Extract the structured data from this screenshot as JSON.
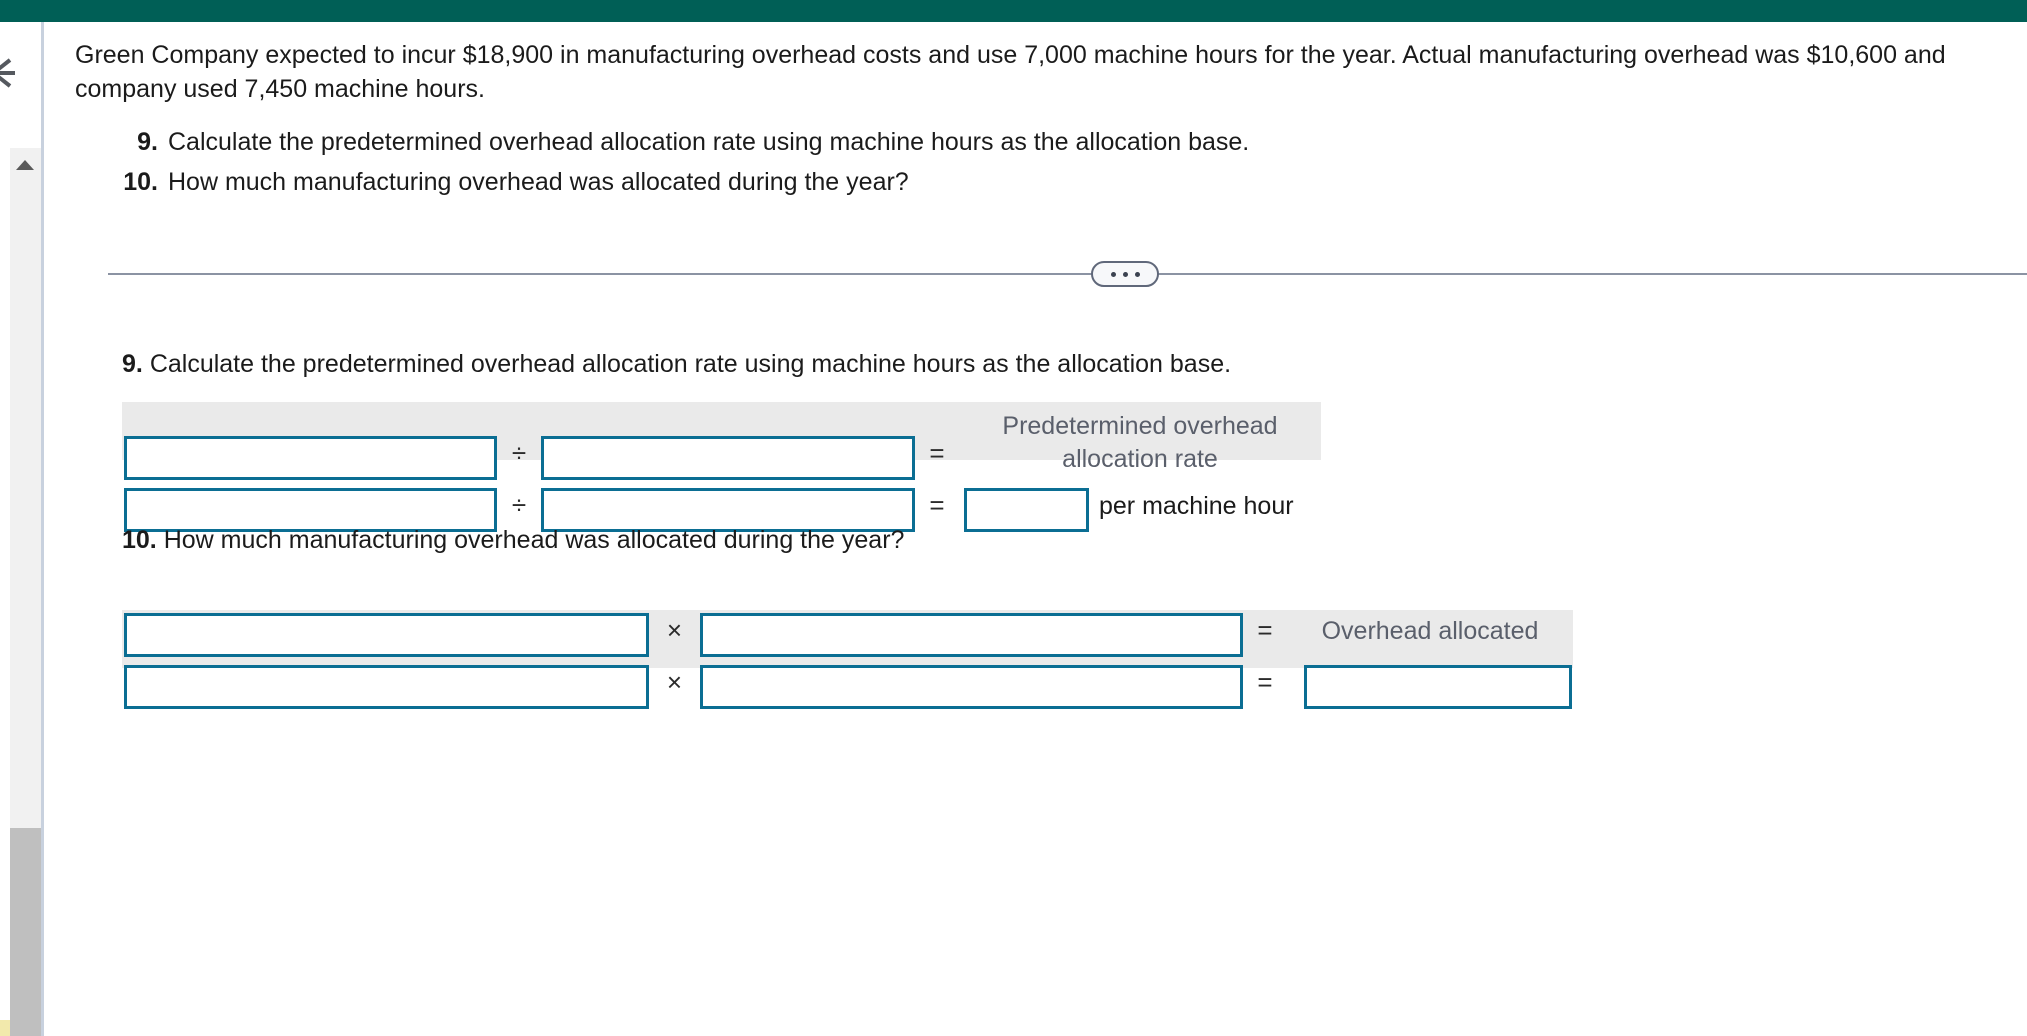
{
  "header": {
    "bar_color": "#005f56"
  },
  "left_rail": {
    "collapse_icon": "collapse-chevron-icon",
    "scroll_up_icon": "scroll-up-arrow-icon"
  },
  "prompt": {
    "text": "Green Company expected to incur $18,900 in manufacturing overhead costs and use 7,000 machine hours for the year. Actual manufacturing overhead was $10,600 and\ncompany used 7,450 machine hours."
  },
  "questions": [
    {
      "number": "9.",
      "text": "Calculate the predetermined overhead allocation rate using machine hours as the allocation base."
    },
    {
      "number": "10.",
      "text": "How much manufacturing overhead was allocated during the year?"
    }
  ],
  "divider": {
    "icon": "ellipsis-icon",
    "dots": [
      "•",
      "•",
      "•"
    ]
  },
  "worksheet": {
    "q9": {
      "number": "9.",
      "text": "Calculate the predetermined overhead allocation rate using machine hours as the allocation base.",
      "result_label": "Predetermined overhead allocation rate",
      "operators": {
        "divide": "÷",
        "equals": "="
      },
      "unit_label": "per machine hour",
      "inputs": {
        "r1_numerator": "",
        "r1_denominator": "",
        "r2_numerator": "",
        "r2_denominator": "",
        "r2_result": ""
      }
    },
    "q10": {
      "number": "10.",
      "text": "How much manufacturing overhead was allocated during the year?",
      "result_label": "Overhead allocated",
      "operators": {
        "multiply": "×",
        "equals": "="
      },
      "inputs": {
        "r1_factor1": "",
        "r1_factor2": "",
        "r2_factor1": "",
        "r2_factor2": "",
        "r2_result": ""
      }
    }
  },
  "colors": {
    "header_teal": "#005f56",
    "input_border": "#0b6e93",
    "band_gray": "#eaeaea",
    "label_gray": "#5a5f6b",
    "divider_gray": "#8b93a3",
    "scroll_thumb": "#bfbfbf"
  }
}
